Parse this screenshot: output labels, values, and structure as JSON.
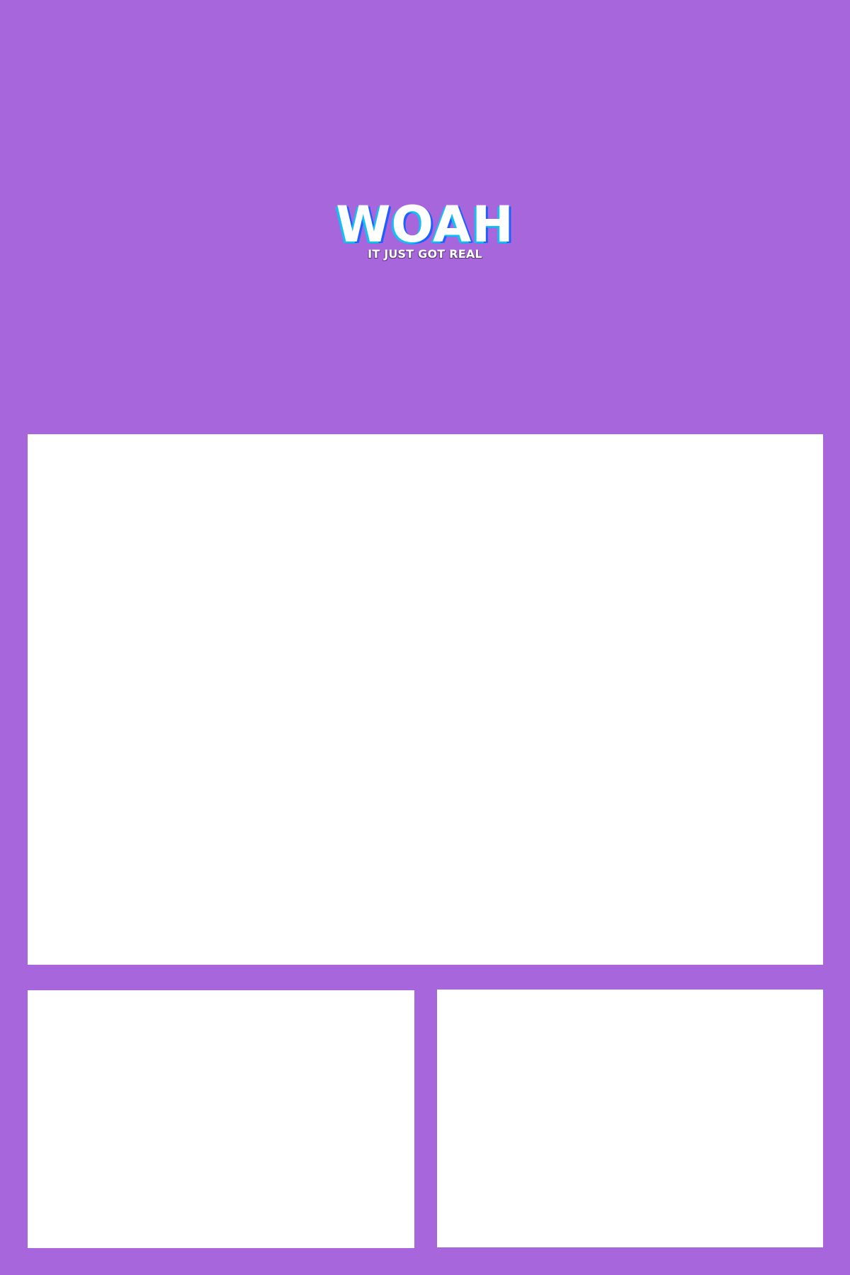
{
  "hero": {
    "title": "WOAH",
    "subtitle": "IT JUST GOT REAL"
  },
  "colors": {
    "background": "#a866dc",
    "panel": "#ffffff",
    "title_shadow_cyan": "#16bff2",
    "title_shadow_blue": "#1d5fff"
  }
}
